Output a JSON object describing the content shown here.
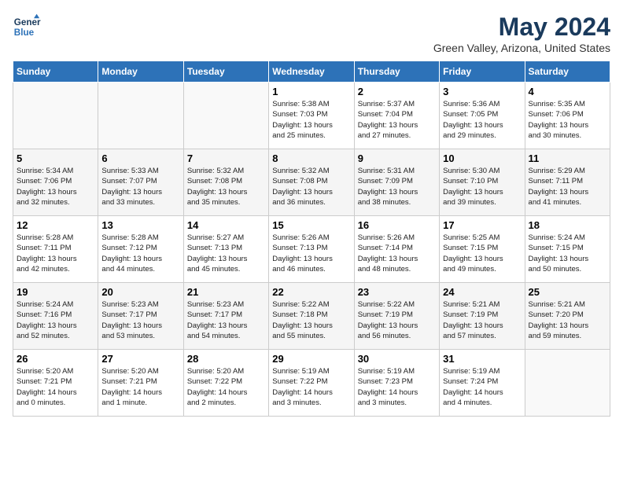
{
  "header": {
    "logo_line1": "General",
    "logo_line2": "Blue",
    "month": "May 2024",
    "location": "Green Valley, Arizona, United States"
  },
  "weekdays": [
    "Sunday",
    "Monday",
    "Tuesday",
    "Wednesday",
    "Thursday",
    "Friday",
    "Saturday"
  ],
  "weeks": [
    [
      {
        "day": "",
        "info": ""
      },
      {
        "day": "",
        "info": ""
      },
      {
        "day": "",
        "info": ""
      },
      {
        "day": "1",
        "info": "Sunrise: 5:38 AM\nSunset: 7:03 PM\nDaylight: 13 hours\nand 25 minutes."
      },
      {
        "day": "2",
        "info": "Sunrise: 5:37 AM\nSunset: 7:04 PM\nDaylight: 13 hours\nand 27 minutes."
      },
      {
        "day": "3",
        "info": "Sunrise: 5:36 AM\nSunset: 7:05 PM\nDaylight: 13 hours\nand 29 minutes."
      },
      {
        "day": "4",
        "info": "Sunrise: 5:35 AM\nSunset: 7:06 PM\nDaylight: 13 hours\nand 30 minutes."
      }
    ],
    [
      {
        "day": "5",
        "info": "Sunrise: 5:34 AM\nSunset: 7:06 PM\nDaylight: 13 hours\nand 32 minutes."
      },
      {
        "day": "6",
        "info": "Sunrise: 5:33 AM\nSunset: 7:07 PM\nDaylight: 13 hours\nand 33 minutes."
      },
      {
        "day": "7",
        "info": "Sunrise: 5:32 AM\nSunset: 7:08 PM\nDaylight: 13 hours\nand 35 minutes."
      },
      {
        "day": "8",
        "info": "Sunrise: 5:32 AM\nSunset: 7:08 PM\nDaylight: 13 hours\nand 36 minutes."
      },
      {
        "day": "9",
        "info": "Sunrise: 5:31 AM\nSunset: 7:09 PM\nDaylight: 13 hours\nand 38 minutes."
      },
      {
        "day": "10",
        "info": "Sunrise: 5:30 AM\nSunset: 7:10 PM\nDaylight: 13 hours\nand 39 minutes."
      },
      {
        "day": "11",
        "info": "Sunrise: 5:29 AM\nSunset: 7:11 PM\nDaylight: 13 hours\nand 41 minutes."
      }
    ],
    [
      {
        "day": "12",
        "info": "Sunrise: 5:28 AM\nSunset: 7:11 PM\nDaylight: 13 hours\nand 42 minutes."
      },
      {
        "day": "13",
        "info": "Sunrise: 5:28 AM\nSunset: 7:12 PM\nDaylight: 13 hours\nand 44 minutes."
      },
      {
        "day": "14",
        "info": "Sunrise: 5:27 AM\nSunset: 7:13 PM\nDaylight: 13 hours\nand 45 minutes."
      },
      {
        "day": "15",
        "info": "Sunrise: 5:26 AM\nSunset: 7:13 PM\nDaylight: 13 hours\nand 46 minutes."
      },
      {
        "day": "16",
        "info": "Sunrise: 5:26 AM\nSunset: 7:14 PM\nDaylight: 13 hours\nand 48 minutes."
      },
      {
        "day": "17",
        "info": "Sunrise: 5:25 AM\nSunset: 7:15 PM\nDaylight: 13 hours\nand 49 minutes."
      },
      {
        "day": "18",
        "info": "Sunrise: 5:24 AM\nSunset: 7:15 PM\nDaylight: 13 hours\nand 50 minutes."
      }
    ],
    [
      {
        "day": "19",
        "info": "Sunrise: 5:24 AM\nSunset: 7:16 PM\nDaylight: 13 hours\nand 52 minutes."
      },
      {
        "day": "20",
        "info": "Sunrise: 5:23 AM\nSunset: 7:17 PM\nDaylight: 13 hours\nand 53 minutes."
      },
      {
        "day": "21",
        "info": "Sunrise: 5:23 AM\nSunset: 7:17 PM\nDaylight: 13 hours\nand 54 minutes."
      },
      {
        "day": "22",
        "info": "Sunrise: 5:22 AM\nSunset: 7:18 PM\nDaylight: 13 hours\nand 55 minutes."
      },
      {
        "day": "23",
        "info": "Sunrise: 5:22 AM\nSunset: 7:19 PM\nDaylight: 13 hours\nand 56 minutes."
      },
      {
        "day": "24",
        "info": "Sunrise: 5:21 AM\nSunset: 7:19 PM\nDaylight: 13 hours\nand 57 minutes."
      },
      {
        "day": "25",
        "info": "Sunrise: 5:21 AM\nSunset: 7:20 PM\nDaylight: 13 hours\nand 59 minutes."
      }
    ],
    [
      {
        "day": "26",
        "info": "Sunrise: 5:20 AM\nSunset: 7:21 PM\nDaylight: 14 hours\nand 0 minutes."
      },
      {
        "day": "27",
        "info": "Sunrise: 5:20 AM\nSunset: 7:21 PM\nDaylight: 14 hours\nand 1 minute."
      },
      {
        "day": "28",
        "info": "Sunrise: 5:20 AM\nSunset: 7:22 PM\nDaylight: 14 hours\nand 2 minutes."
      },
      {
        "day": "29",
        "info": "Sunrise: 5:19 AM\nSunset: 7:22 PM\nDaylight: 14 hours\nand 3 minutes."
      },
      {
        "day": "30",
        "info": "Sunrise: 5:19 AM\nSunset: 7:23 PM\nDaylight: 14 hours\nand 3 minutes."
      },
      {
        "day": "31",
        "info": "Sunrise: 5:19 AM\nSunset: 7:24 PM\nDaylight: 14 hours\nand 4 minutes."
      },
      {
        "day": "",
        "info": ""
      }
    ]
  ]
}
